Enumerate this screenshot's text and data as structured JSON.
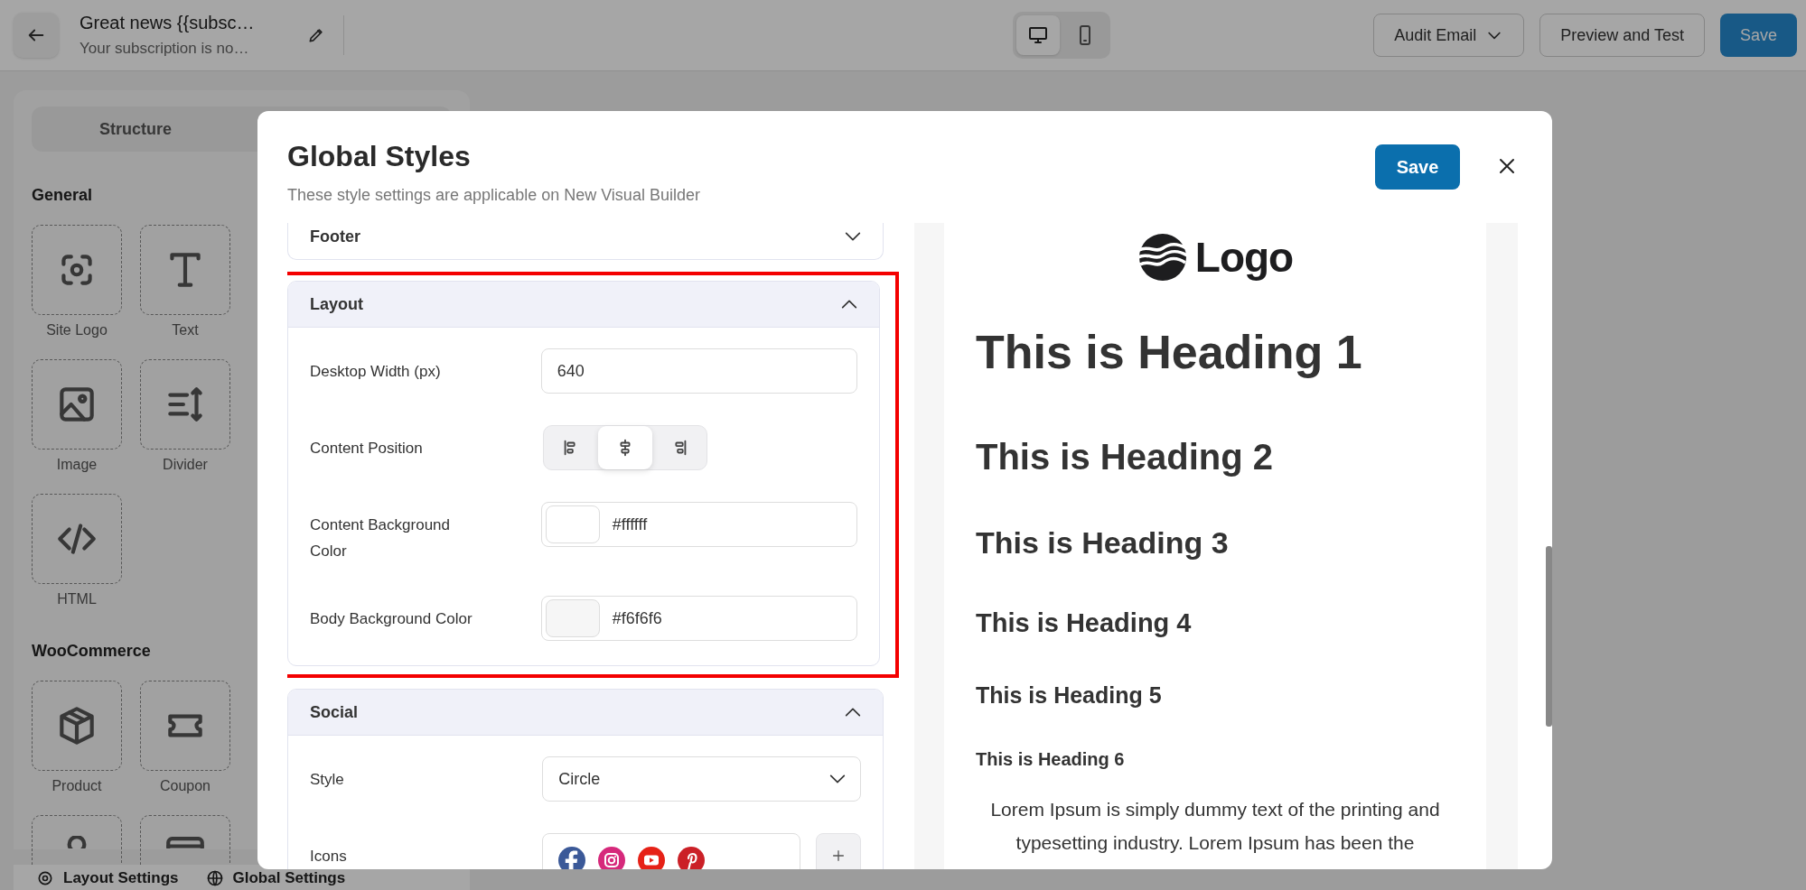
{
  "topbar": {
    "title": "Great news {{subsc…",
    "subtitle": "Your subscription is no…",
    "devices": [
      {
        "kind": "desktop",
        "selected": true
      },
      {
        "kind": "mobile",
        "selected": false
      }
    ],
    "buttons": [
      {
        "kind": "dropdown",
        "label": "Audit Email"
      },
      {
        "kind": "outline",
        "label": "Preview and Test"
      },
      {
        "kind": "primary",
        "label": "Save"
      }
    ]
  },
  "sidebar": {
    "tabs": [
      {
        "label": "Structure",
        "selected": false
      }
    ],
    "sections": [
      {
        "title": "General",
        "items": [
          {
            "kind": "logo",
            "label": "Site Logo"
          },
          {
            "kind": "text",
            "label": "Text"
          },
          {
            "kind": "image",
            "label": "Image"
          },
          {
            "kind": "divider",
            "label": "Divider"
          },
          {
            "kind": "html",
            "label": "HTML"
          }
        ]
      },
      {
        "title": "WooCommerce",
        "items": [
          {
            "kind": "product",
            "label": "Product"
          },
          {
            "kind": "coupon",
            "label": "Coupon"
          },
          {
            "kind": "person"
          },
          {
            "kind": "card"
          }
        ]
      }
    ],
    "footer": [
      {
        "kind": "gear",
        "label": "Layout Settings"
      },
      {
        "kind": "globe",
        "label": "Global Settings"
      }
    ]
  },
  "modal": {
    "title": "Global Styles",
    "subtitle": "These style settings are applicable on New Visual Builder",
    "save": "Save",
    "sections": [
      {
        "title": "Footer",
        "expanded": false,
        "highlighted": false
      },
      {
        "title": "Layout",
        "expanded": true,
        "highlighted": true,
        "fields": [
          {
            "kind": "text",
            "label": "Desktop Width (px)",
            "value": "640"
          },
          {
            "kind": "align",
            "label": "Content Position",
            "options": [
              {
                "kind": "left",
                "selected": false
              },
              {
                "kind": "center",
                "selected": true
              },
              {
                "kind": "right",
                "selected": false
              }
            ]
          },
          {
            "kind": "color",
            "label": "Content Background Color",
            "value": "#ffffff",
            "color": "#ffffff"
          },
          {
            "kind": "color",
            "label": "Body Background Color",
            "value": "#f6f6f6",
            "color": "#f6f6f6"
          }
        ]
      },
      {
        "title": "Social",
        "expanded": true,
        "highlighted": false,
        "fields": [
          {
            "kind": "select",
            "label": "Style",
            "value": "Circle"
          },
          {
            "kind": "icons",
            "label": "Icons",
            "items": [
              {
                "kind": "facebook"
              },
              {
                "kind": "instagram"
              },
              {
                "kind": "youtube"
              },
              {
                "kind": "pinterest"
              }
            ]
          }
        ]
      }
    ],
    "preview": {
      "logo": "Logo",
      "headings": [
        "This is Heading 1",
        "This is Heading 2",
        "This is Heading 3",
        "This is Heading 4",
        "This is Heading 5",
        "This is Heading 6"
      ],
      "paragraph": "Lorem Ipsum is simply dummy text of the printing and typesetting industry. Lorem Ipsum has been the"
    }
  }
}
